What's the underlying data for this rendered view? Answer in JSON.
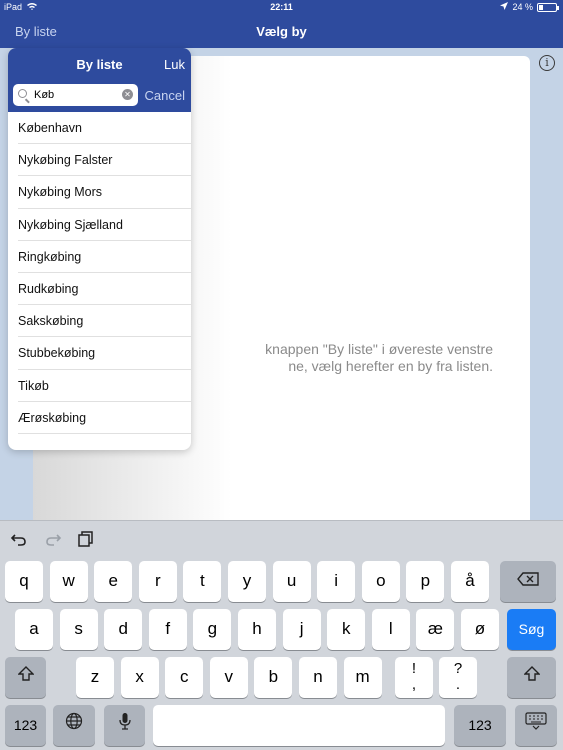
{
  "status_bar": {
    "device": "iPad",
    "time": "22:11",
    "battery": "24 %",
    "battery_level": 0.24
  },
  "nav_bar": {
    "back_label": "By liste",
    "title": "Vælg by"
  },
  "main": {
    "hint_line1": "knappen \"By liste\" i øvereste venstre",
    "hint_line2": "ne, vælg herefter en by fra listen."
  },
  "popover": {
    "title": "By liste",
    "close_label": "Luk",
    "search": {
      "value": "Køb",
      "cancel_label": "Cancel"
    },
    "cities": [
      "København",
      "Nykøbing Falster",
      "Nykøbing Mors",
      "Nykøbing Sjælland",
      "Ringkøbing",
      "Rudkøbing",
      "Sakskøbing",
      "Stubbekøbing",
      "Tikøb",
      "Ærøskøbing"
    ]
  },
  "keyboard": {
    "row1": [
      "q",
      "w",
      "e",
      "r",
      "t",
      "y",
      "u",
      "i",
      "o",
      "p",
      "å"
    ],
    "row2": [
      "a",
      "s",
      "d",
      "f",
      "g",
      "h",
      "j",
      "k",
      "l",
      "æ",
      "ø"
    ],
    "row3": [
      "z",
      "x",
      "c",
      "v",
      "b",
      "n",
      "m"
    ],
    "punct1": {
      "top": "!",
      "bottom": ","
    },
    "punct2": {
      "top": "?",
      "bottom": "."
    },
    "search_key": "Søg",
    "numbers_key": "123"
  },
  "colors": {
    "bar": "#2e4b9e",
    "accent": "#1a7cf5",
    "keyboard_bg": "#d1d5db"
  }
}
